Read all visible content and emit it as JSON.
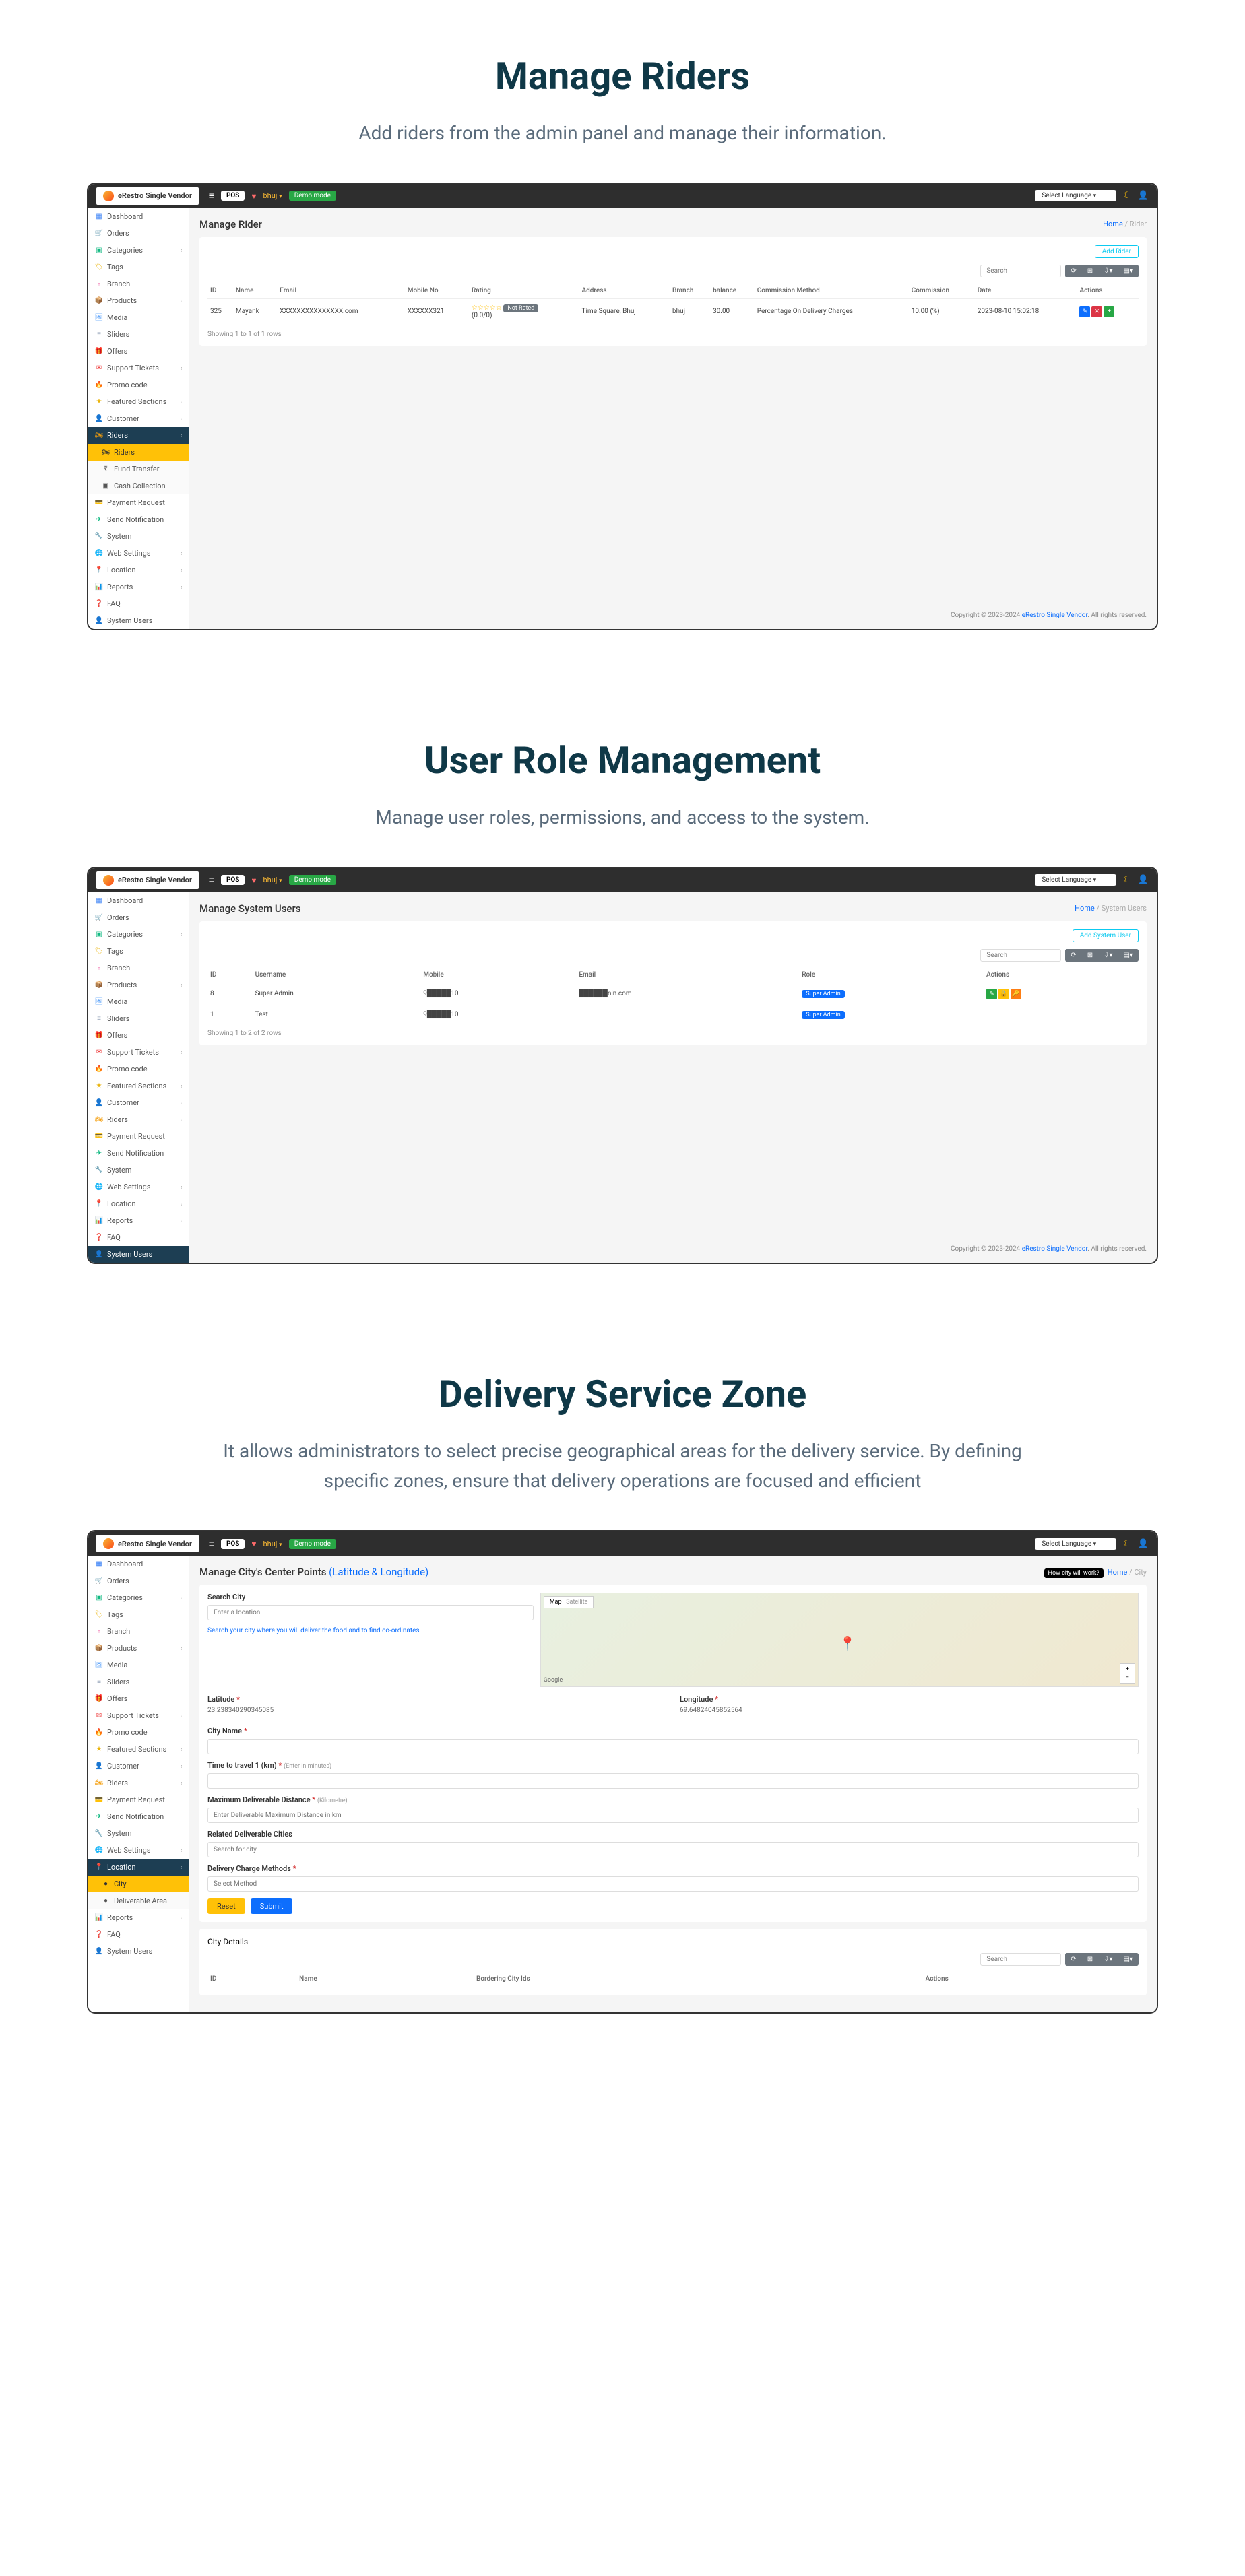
{
  "brand": "eRestro Single Vendor",
  "topbar": {
    "pos": "POS",
    "location": "bhuj",
    "demo": "Demo mode",
    "lang": "Select Language"
  },
  "sections": [
    {
      "title": "Manage Riders",
      "desc": "Add riders from the admin panel and manage their information.",
      "page_title": "Manage Rider",
      "breadcrumb": [
        "Home",
        "Rider"
      ],
      "add_btn": "Add Rider",
      "nav": [
        {
          "icon": "▦",
          "label": "Dashboard",
          "color": "#3b82f6"
        },
        {
          "icon": "🛒",
          "label": "Orders",
          "color": "#f59e0b"
        },
        {
          "icon": "▣",
          "label": "Categories",
          "color": "#10b981",
          "chev": true
        },
        {
          "icon": "🏷",
          "label": "Tags",
          "color": "#eab308"
        },
        {
          "icon": "⑂",
          "label": "Branch",
          "color": "#ec4899"
        },
        {
          "icon": "📦",
          "label": "Products",
          "color": "#ef4444",
          "chev": true
        },
        {
          "icon": "🖼",
          "label": "Media",
          "color": "#60a5fa"
        },
        {
          "icon": "≡",
          "label": "Sliders",
          "color": "#94a3b8"
        },
        {
          "icon": "🎁",
          "label": "Offers",
          "color": "#a855f7"
        },
        {
          "icon": "✉",
          "label": "Support Tickets",
          "color": "#ef4444",
          "chev": true
        },
        {
          "icon": "🔥",
          "label": "Promo code",
          "color": "#f97316"
        },
        {
          "icon": "★",
          "label": "Featured Sections",
          "color": "#eab308",
          "chev": true
        },
        {
          "icon": "👤",
          "label": "Customer",
          "color": "#a855f7",
          "chev": true
        },
        {
          "icon": "🏍",
          "label": "Riders",
          "color": "#f59e0b",
          "chev": true,
          "active": true
        },
        {
          "icon": "🏍",
          "label": "Riders",
          "sub": true,
          "active": true
        },
        {
          "icon": "₹",
          "label": "Fund Transfer",
          "sub": true
        },
        {
          "icon": "▣",
          "label": "Cash Collection",
          "sub": true
        },
        {
          "icon": "💳",
          "label": "Payment Request",
          "color": "#ef4444"
        },
        {
          "icon": "✈",
          "label": "Send Notification",
          "color": "#10b981"
        },
        {
          "icon": "🔧",
          "label": "System",
          "color": "#f59e0b"
        },
        {
          "icon": "🌐",
          "label": "Web Settings",
          "color": "#10b981",
          "chev": true
        },
        {
          "icon": "📍",
          "label": "Location",
          "color": "#ef4444",
          "chev": true
        },
        {
          "icon": "📊",
          "label": "Reports",
          "color": "#3b82f6",
          "chev": true
        },
        {
          "icon": "❓",
          "label": "FAQ",
          "color": "#eab308"
        },
        {
          "icon": "👤",
          "label": "System Users",
          "color": "#ef4444"
        }
      ],
      "columns": [
        "ID",
        "Name",
        "Email",
        "Mobile No",
        "Rating",
        "Address",
        "Branch",
        "balance",
        "Commission Method",
        "Commission",
        "Date",
        "Actions"
      ],
      "rows": [
        {
          "id": "325",
          "name": "Mayank",
          "email": "XXXXXXXXXXXXXXX.com",
          "mobile": "XXXXXX321",
          "rating": "(0.0/0)",
          "status": "Not Rated",
          "address": "Time Square, Bhuj",
          "branch": "bhuj",
          "balance": "30.00",
          "method": "Percentage On Delivery Charges",
          "commission": "10.00 (%)",
          "date": "2023-08-10 15:02:18"
        }
      ],
      "summary": "Showing 1 to 1 of 1 rows"
    },
    {
      "title": "User Role Management",
      "desc": "Manage user roles, permissions, and access to the system.",
      "page_title": "Manage System Users",
      "breadcrumb": [
        "Home",
        "System Users"
      ],
      "add_btn": "Add System User",
      "nav": [
        {
          "icon": "▦",
          "label": "Dashboard",
          "color": "#3b82f6"
        },
        {
          "icon": "🛒",
          "label": "Orders",
          "color": "#f59e0b"
        },
        {
          "icon": "▣",
          "label": "Categories",
          "color": "#10b981",
          "chev": true
        },
        {
          "icon": "🏷",
          "label": "Tags",
          "color": "#eab308"
        },
        {
          "icon": "⑂",
          "label": "Branch",
          "color": "#ec4899"
        },
        {
          "icon": "📦",
          "label": "Products",
          "color": "#ef4444",
          "chev": true
        },
        {
          "icon": "🖼",
          "label": "Media",
          "color": "#60a5fa"
        },
        {
          "icon": "≡",
          "label": "Sliders",
          "color": "#94a3b8"
        },
        {
          "icon": "🎁",
          "label": "Offers",
          "color": "#a855f7"
        },
        {
          "icon": "✉",
          "label": "Support Tickets",
          "color": "#ef4444",
          "chev": true
        },
        {
          "icon": "🔥",
          "label": "Promo code",
          "color": "#f97316"
        },
        {
          "icon": "★",
          "label": "Featured Sections",
          "color": "#eab308",
          "chev": true
        },
        {
          "icon": "👤",
          "label": "Customer",
          "color": "#a855f7",
          "chev": true
        },
        {
          "icon": "🏍",
          "label": "Riders",
          "color": "#f59e0b",
          "chev": true
        },
        {
          "icon": "💳",
          "label": "Payment Request",
          "color": "#ef4444"
        },
        {
          "icon": "✈",
          "label": "Send Notification",
          "color": "#10b981"
        },
        {
          "icon": "🔧",
          "label": "System",
          "color": "#f59e0b"
        },
        {
          "icon": "🌐",
          "label": "Web Settings",
          "color": "#10b981",
          "chev": true
        },
        {
          "icon": "📍",
          "label": "Location",
          "color": "#ef4444",
          "chev": true
        },
        {
          "icon": "📊",
          "label": "Reports",
          "color": "#3b82f6",
          "chev": true
        },
        {
          "icon": "❓",
          "label": "FAQ",
          "color": "#eab308"
        },
        {
          "icon": "👤",
          "label": "System Users",
          "color": "#ef4444",
          "active": true
        }
      ],
      "columns": [
        "ID",
        "Username",
        "Mobile",
        "Email",
        "Role",
        "Actions"
      ],
      "rows": [
        {
          "id": "8",
          "username": "Super Admin",
          "mobile": "9█████10",
          "email": "██████nin.com",
          "role": "Super Admin"
        },
        {
          "id": "1",
          "username": "Test",
          "mobile": "9█████10",
          "email": "",
          "role": "Super Admin"
        }
      ],
      "summary": "Showing 1 to 2 of 2 rows"
    },
    {
      "title": "Delivery Service Zone",
      "desc": "It allows administrators to select precise geographical areas for the delivery service. By defining specific zones, ensure that delivery operations are focused and efficient",
      "page_title": "Manage City's Center Points",
      "page_subtitle": "(Latitude & Longitude)",
      "breadcrumb": [
        "Home",
        "City"
      ],
      "how_badge": "How city will work?",
      "nav": [
        {
          "icon": "▦",
          "label": "Dashboard",
          "color": "#3b82f6"
        },
        {
          "icon": "🛒",
          "label": "Orders",
          "color": "#f59e0b"
        },
        {
          "icon": "▣",
          "label": "Categories",
          "color": "#10b981",
          "chev": true
        },
        {
          "icon": "🏷",
          "label": "Tags",
          "color": "#eab308"
        },
        {
          "icon": "⑂",
          "label": "Branch",
          "color": "#ec4899"
        },
        {
          "icon": "📦",
          "label": "Products",
          "color": "#ef4444",
          "chev": true
        },
        {
          "icon": "🖼",
          "label": "Media",
          "color": "#60a5fa"
        },
        {
          "icon": "≡",
          "label": "Sliders",
          "color": "#94a3b8"
        },
        {
          "icon": "🎁",
          "label": "Offers",
          "color": "#a855f7"
        },
        {
          "icon": "✉",
          "label": "Support Tickets",
          "color": "#ef4444",
          "chev": true
        },
        {
          "icon": "🔥",
          "label": "Promo code",
          "color": "#f97316"
        },
        {
          "icon": "★",
          "label": "Featured Sections",
          "color": "#eab308",
          "chev": true
        },
        {
          "icon": "👤",
          "label": "Customer",
          "color": "#a855f7",
          "chev": true
        },
        {
          "icon": "🏍",
          "label": "Riders",
          "color": "#f59e0b",
          "chev": true
        },
        {
          "icon": "💳",
          "label": "Payment Request",
          "color": "#ef4444"
        },
        {
          "icon": "✈",
          "label": "Send Notification",
          "color": "#10b981"
        },
        {
          "icon": "🔧",
          "label": "System",
          "color": "#f59e0b"
        },
        {
          "icon": "🌐",
          "label": "Web Settings",
          "color": "#10b981",
          "chev": true
        },
        {
          "icon": "📍",
          "label": "Location",
          "color": "#ef4444",
          "chev": true,
          "active": true
        },
        {
          "icon": "●",
          "label": "City",
          "sub": true,
          "active": true
        },
        {
          "icon": "●",
          "label": "Deliverable Area",
          "sub": true
        },
        {
          "icon": "📊",
          "label": "Reports",
          "color": "#3b82f6",
          "chev": true
        },
        {
          "icon": "❓",
          "label": "FAQ",
          "color": "#eab308"
        },
        {
          "icon": "👤",
          "label": "System Users",
          "color": "#ef4444"
        }
      ],
      "form": {
        "search_label": "Search City",
        "search_placeholder": "Enter a location",
        "search_hint": "Search your city where you will deliver the food and to find co-ordinates",
        "map_tabs": [
          "Map",
          "Satellite"
        ],
        "lat_label": "Latitude",
        "lat_val": "23.238340290345085",
        "lng_label": "Longitude",
        "lng_val": "69.64824045852564",
        "city_label": "City Name",
        "time_label": "Time to travel 1 (km)",
        "time_hint": "(Enter in minutes)",
        "dist_label": "Maximum Deliverable Distance",
        "dist_hint": "(Kilometre)",
        "dist_placeholder": "Enter Deliverable Maximum Distance in km",
        "cities_label": "Related Deliverable Cities",
        "cities_placeholder": "Search for city",
        "method_label": "Delivery Charge Methods",
        "method_placeholder": "Select Method",
        "reset": "Reset",
        "submit": "Submit",
        "details_title": "City Details",
        "details_cols": [
          "ID",
          "Name",
          "Bordering City Ids",
          "Actions"
        ]
      }
    }
  ],
  "search_placeholder": "Search",
  "footer": {
    "text": "Copyright © 2023-2024 ",
    "link": "eRestro Single Vendor",
    "suffix": ". All rights reserved."
  }
}
